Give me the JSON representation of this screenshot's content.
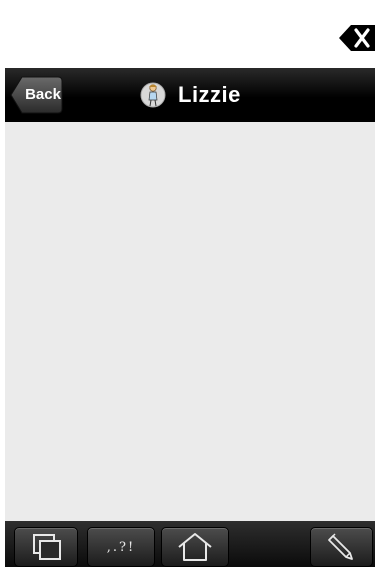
{
  "nav": {
    "back_label": "Back",
    "title": "Lizzie",
    "avatar_icon": "girl-figure-icon"
  },
  "header": {
    "clear_icon": "clear-backspace-icon"
  },
  "toolbar": {
    "copy_icon": "copy-icon",
    "punctuation_label": ",.?!",
    "home_icon": "home-icon",
    "edit_icon": "pencil-icon"
  },
  "colors": {
    "nav_background": "#000000",
    "content_background": "#ebebeb",
    "toolbar_background": "#1a1a1a"
  }
}
